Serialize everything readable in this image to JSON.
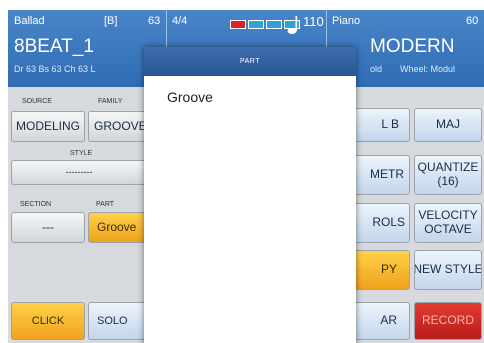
{
  "topbar": {
    "style_name": "Ballad",
    "bank_label": "[B]",
    "style_number": "63",
    "time_signature": "4/4",
    "tempo": "110",
    "voice_name": "Piano",
    "voice_number": "60",
    "style_big": "8BEAT_1",
    "voice_big": "MODERN",
    "info_left": "Dr 63  Bs 63  Ch 63  L",
    "info_right_1": "old",
    "info_right_2": "Wheel: Modul"
  },
  "left_panel": {
    "source_label": "SOURCE",
    "family_label": "FAMILY",
    "modeling_button": "MODELING",
    "groove_family_button": "GROOVE",
    "style_label": "STYLE",
    "style_value": "---------",
    "section_label": "SECTION",
    "part_label": "PART",
    "section_value": "---",
    "part_value": "Groove",
    "click_button": "CLICK",
    "solo_button": "SOLO"
  },
  "right_panel": {
    "btn_b": "L B",
    "btn_maj": "MAJ",
    "btn_metr": "METR",
    "btn_quantize": "QUANTIZE (16)",
    "btn_rols": "ROLS",
    "btn_velocity": "VELOCITY OCTAVE",
    "btn_py": "PY",
    "btn_new_style": "NEW STYLE",
    "btn_ar": "AR",
    "btn_record": "RECORD"
  },
  "popup": {
    "title": "PART",
    "items": [
      "Groove"
    ]
  },
  "colors": {
    "header_blue": "#2f6cb4",
    "accent_orange": "#f0a21c",
    "record_red": "#c4221c"
  }
}
